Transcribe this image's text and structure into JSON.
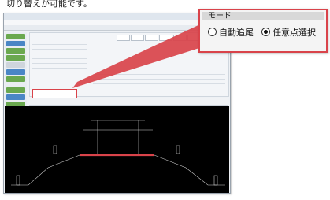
{
  "caption": "切り替えが可能です。",
  "callout": {
    "title": "モード",
    "options": [
      {
        "label": "自動追尾",
        "selected": false
      },
      {
        "label": "任意点選択",
        "selected": true
      }
    ]
  },
  "colors": {
    "accent_red": "#d9434a",
    "sidebar_green": "#6aa84f",
    "sidebar_blue": "#4a86c5",
    "cad_bg": "#000000"
  }
}
